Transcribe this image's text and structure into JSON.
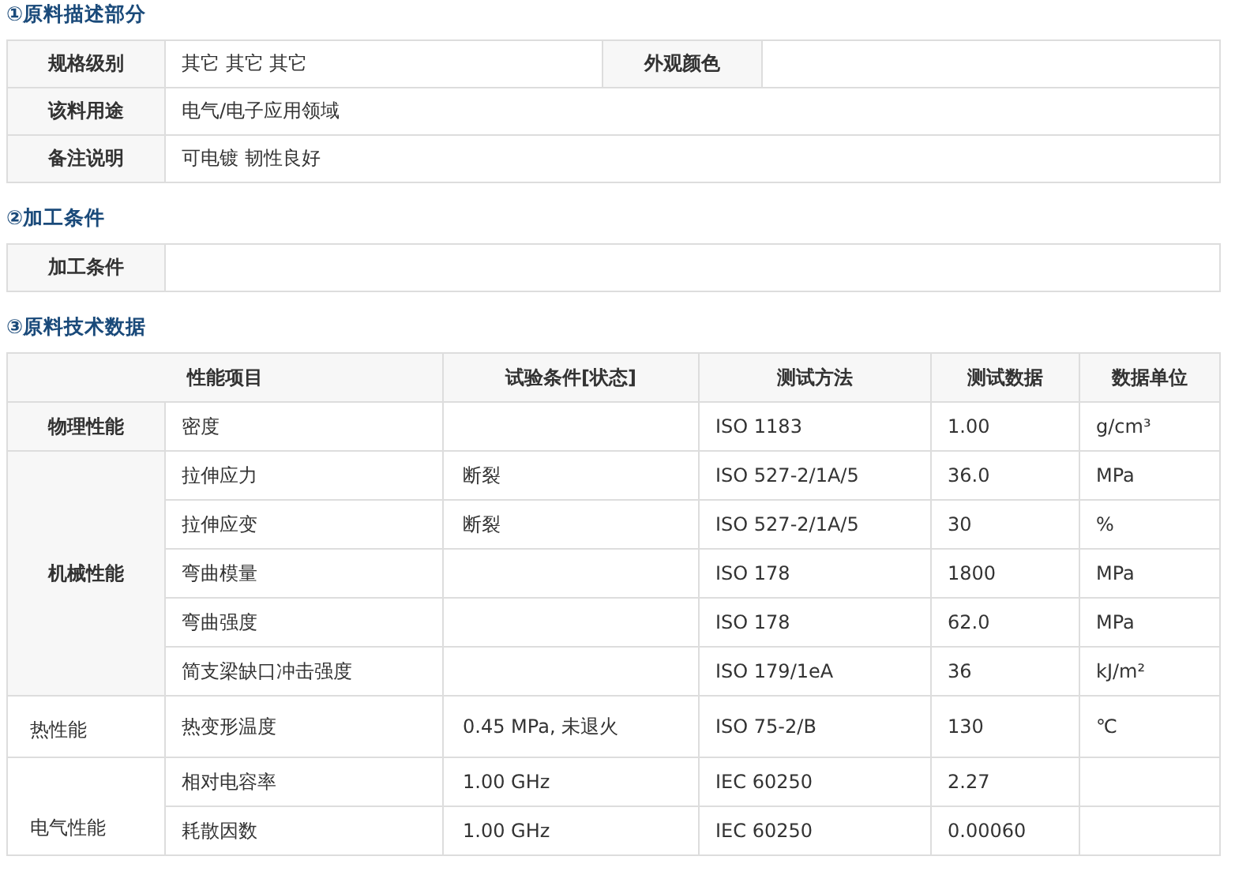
{
  "description": {
    "title": "①原料描述部分",
    "rows": [
      {
        "label": "规格级别",
        "value": "其它 其它 其它",
        "label_2": "外观颜色"
      },
      {
        "label": "该料用途",
        "value": "电气/电子应用领域"
      },
      {
        "label": "备注说明",
        "value": "可电镀 韧性良好"
      }
    ]
  },
  "processing": {
    "title": "②加工条件",
    "rows": [
      {
        "label": "加工条件"
      }
    ]
  },
  "technical_data": {
    "title": "③原料技术数据",
    "columns": [
      "性能项目",
      "试验条件[状态]",
      "测试方法",
      "测试数据",
      "数据单位"
    ],
    "groups": [
      {
        "name": "物理性能",
        "emphasized": true,
        "rows": [
          {
            "item": "密度",
            "method": "ISO 1183",
            "value": "1.00",
            "unit": "g/cm³"
          }
        ]
      },
      {
        "name": "机械性能",
        "emphasized": true,
        "rows": [
          {
            "item": "拉伸应力",
            "condition": "断裂",
            "method": "ISO 527-2/1A/5",
            "value": "36.0",
            "unit": "MPa"
          },
          {
            "item": "拉伸应变",
            "condition": "断裂",
            "method": "ISO 527-2/1A/5",
            "value": "30",
            "unit": "%"
          },
          {
            "item": "弯曲模量",
            "method": "ISO 178",
            "value": "1800",
            "unit": "MPa"
          },
          {
            "item": "弯曲强度",
            "method": "ISO 178",
            "value": "62.0",
            "unit": "MPa"
          },
          {
            "item": "简支梁缺口冲击强度",
            "method": "ISO 179/1eA",
            "value": "36",
            "unit": "kJ/m²"
          }
        ]
      },
      {
        "name": "热性能",
        "emphasized": false,
        "rows": [
          {
            "item": "热变形温度",
            "condition": "0.45 MPa, 未退火",
            "method": "ISO 75-2/B",
            "value": "130",
            "unit": "℃"
          }
        ]
      },
      {
        "name": "电气性能",
        "emphasized": false,
        "rows": [
          {
            "item": "相对电容率",
            "condition": "1.00 GHz",
            "method": "IEC 60250",
            "value": "2.27"
          },
          {
            "item": "耗散因数",
            "condition": "1.00 GHz",
            "method": "IEC 60250",
            "value": "0.00060"
          }
        ]
      }
    ]
  }
}
